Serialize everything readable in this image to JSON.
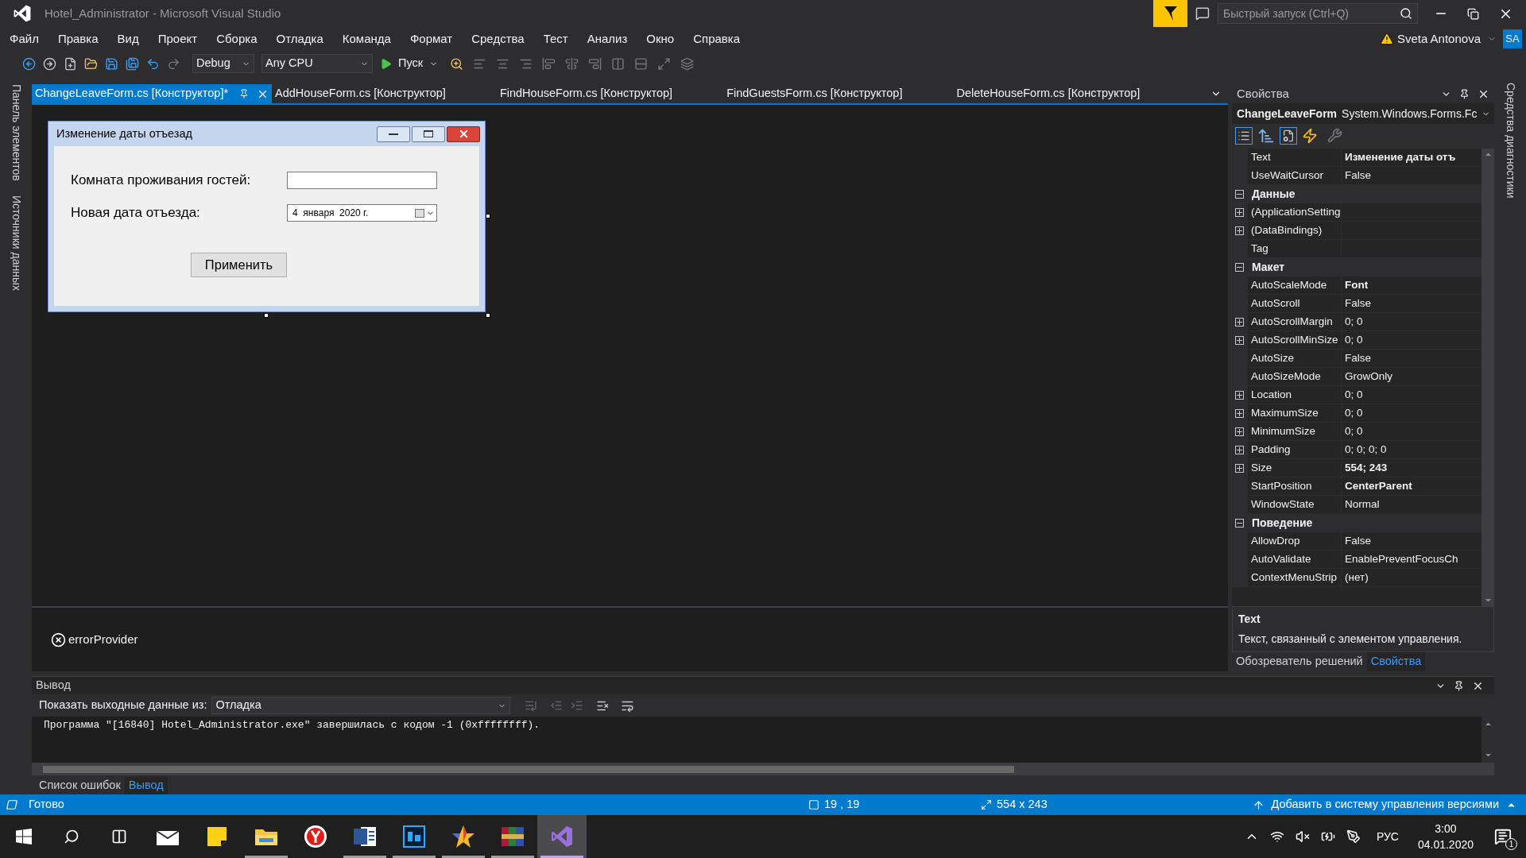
{
  "window": {
    "title": "Hotel_Administrator - Microsoft Visual Studio"
  },
  "quick_launch": {
    "placeholder": "Быстрый запуск (Ctrl+Q)"
  },
  "account": {
    "name": "Sveta Antonova",
    "initials": "SA"
  },
  "menu": [
    "Файл",
    "Правка",
    "Вид",
    "Проект",
    "Сборка",
    "Отладка",
    "Команда",
    "Формат",
    "Средства",
    "Тест",
    "Анализ",
    "Окно",
    "Справка"
  ],
  "toolbar": {
    "configuration": "Debug",
    "platform": "Any CPU",
    "start": "Пуск"
  },
  "left_strip": [
    "Панель элементов",
    "Источники данных"
  ],
  "document_tabs": [
    {
      "label": "ChangeLeaveForm.cs [Конструктор]*",
      "selected": true
    },
    {
      "label": "AddHouseForm.cs [Конструктор]",
      "selected": false
    },
    {
      "label": "FindHouseForm.cs [Конструктор]",
      "selected": false
    },
    {
      "label": "FindGuestsForm.cs [Конструктор]",
      "selected": false
    },
    {
      "label": "DeleteHouseForm.cs [Конструктор]",
      "selected": false
    }
  ],
  "designer": {
    "form": {
      "title": "Изменение даты отъезад",
      "fields": [
        {
          "kind": "textbox",
          "label": "Комната проживания гостей:"
        },
        {
          "kind": "date",
          "label": "Новая дата отъезда:",
          "value": "4  января  2020 г."
        }
      ],
      "button": "Применить"
    },
    "tray": [
      "errorProvider"
    ]
  },
  "properties": {
    "title": "Свойства",
    "object": "ChangeLeaveForm",
    "type": "System.Windows.Forms.Fc",
    "rows": [
      {
        "kind": "property",
        "name": "Text",
        "value": "Изменение даты отъ",
        "modified": true,
        "expandable": false
      },
      {
        "kind": "property",
        "name": "UseWaitCursor",
        "value": "False",
        "modified": false,
        "expandable": false
      },
      {
        "kind": "category",
        "name": "Данные",
        "expanded": true
      },
      {
        "kind": "property",
        "name": "(ApplicationSetting",
        "expandable": true
      },
      {
        "kind": "property",
        "name": "(DataBindings)",
        "expandable": true
      },
      {
        "kind": "property",
        "name": "Tag",
        "expandable": false
      },
      {
        "kind": "category",
        "name": "Макет",
        "expanded": true
      },
      {
        "kind": "property",
        "name": "AutoScaleMode",
        "value": "Font",
        "modified": true,
        "expandable": false
      },
      {
        "kind": "property",
        "name": "AutoScroll",
        "value": "False",
        "modified": false,
        "expandable": false
      },
      {
        "kind": "property",
        "name": "AutoScrollMargin",
        "value": "0; 0",
        "modified": false,
        "expandable": true
      },
      {
        "kind": "property",
        "name": "AutoScrollMinSize",
        "value": "0; 0",
        "modified": false,
        "expandable": true
      },
      {
        "kind": "property",
        "name": "AutoSize",
        "value": "False",
        "modified": false,
        "expandable": false
      },
      {
        "kind": "property",
        "name": "AutoSizeMode",
        "value": "GrowOnly",
        "modified": false,
        "expandable": false
      },
      {
        "kind": "property",
        "name": "Location",
        "value": "0; 0",
        "modified": false,
        "expandable": true
      },
      {
        "kind": "property",
        "name": "MaximumSize",
        "value": "0; 0",
        "modified": false,
        "expandable": true
      },
      {
        "kind": "property",
        "name": "MinimumSize",
        "value": "0; 0",
        "modified": false,
        "expandable": true
      },
      {
        "kind": "property",
        "name": "Padding",
        "value": "0; 0; 0; 0",
        "modified": false,
        "expandable": true
      },
      {
        "kind": "property",
        "name": "Size",
        "value": "554; 243",
        "modified": true,
        "expandable": true
      },
      {
        "kind": "property",
        "name": "StartPosition",
        "value": "CenterParent",
        "modified": true,
        "expandable": false
      },
      {
        "kind": "property",
        "name": "WindowState",
        "value": "Normal",
        "modified": false,
        "expandable": false
      },
      {
        "kind": "category",
        "name": "Поведение",
        "expanded": true
      },
      {
        "kind": "property",
        "name": "AllowDrop",
        "value": "False",
        "modified": false,
        "expandable": false
      },
      {
        "kind": "property",
        "name": "AutoValidate",
        "value": "EnablePreventFocusCh",
        "modified": false,
        "expandable": false
      },
      {
        "kind": "property",
        "name": "ContextMenuStrip",
        "value": "(нет)",
        "modified": false,
        "expandable": false
      }
    ],
    "description": {
      "title": "Text",
      "text": "Текст, связанный с элементом управления."
    }
  },
  "side_tabs": [
    {
      "label": "Обозреватель решений",
      "selected": false
    },
    {
      "label": "Свойства",
      "selected": true
    }
  ],
  "right_strip": "Средства диагностики",
  "output": {
    "title": "Вывод",
    "source_label": "Показать выходные данные из:",
    "source": "Отладка",
    "lines": [
      "Программа \"[16840] Hotel_Administrator.exe\" завершилась с кодом -1 (0xffffffff)."
    ]
  },
  "bottom_tabs": [
    {
      "label": "Список ошибок",
      "selected": false
    },
    {
      "label": "Вывод",
      "selected": true
    }
  ],
  "status_bar": {
    "state": "Готово",
    "position": "19 , 19",
    "size": "554 x 243",
    "source_control": "Добавить в систему управления версиями"
  },
  "taskbar": {
    "apps": [
      {
        "kind": "mail",
        "running": false,
        "selected": false
      },
      {
        "kind": "notes",
        "running": false,
        "selected": false
      },
      {
        "kind": "explorer",
        "running": true,
        "selected": false
      },
      {
        "kind": "browser",
        "running": false,
        "selected": false
      },
      {
        "kind": "word",
        "running": true,
        "selected": false
      },
      {
        "kind": "photoshop",
        "running": true,
        "selected": false
      },
      {
        "kind": "star",
        "running": true,
        "selected": false
      },
      {
        "kind": "archiver",
        "running": true,
        "selected": false
      },
      {
        "kind": "studio",
        "running": true,
        "selected": true
      }
    ],
    "language": "РУС",
    "time": "3:00",
    "date": "04.01.2020",
    "notifications": "1"
  }
}
